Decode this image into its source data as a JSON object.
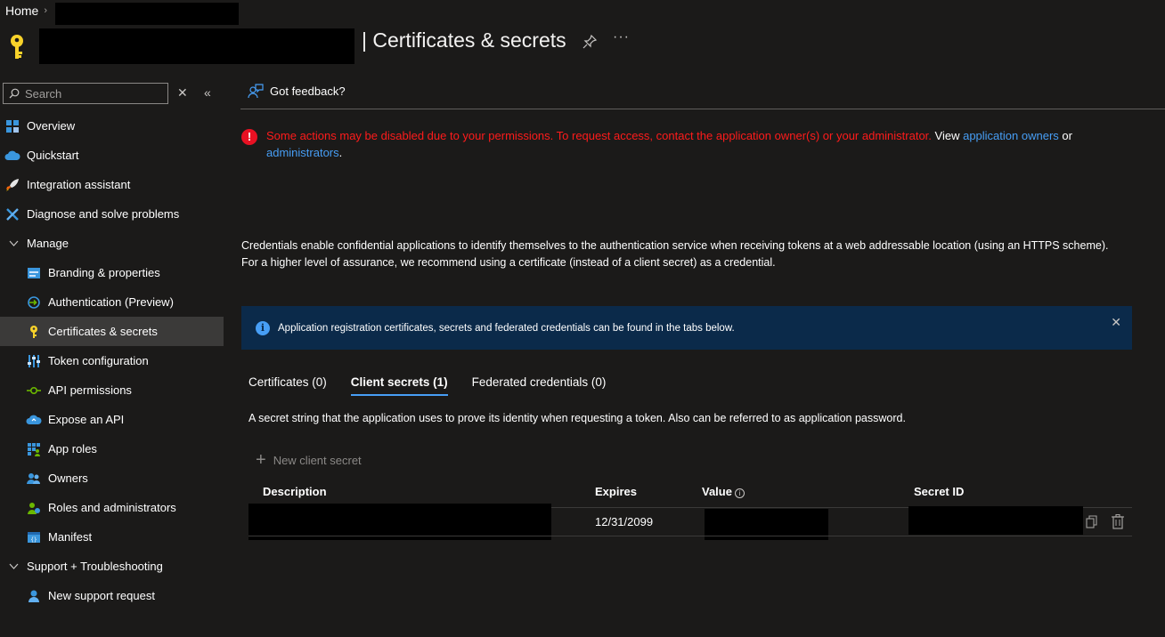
{
  "breadcrumb": {
    "home": "Home",
    "separator": "›"
  },
  "header": {
    "title": "| Certificates & secrets",
    "more": "···"
  },
  "sidebar": {
    "search_placeholder": "Search",
    "close_symbol": "✕",
    "collapse_symbol": "«",
    "items": [
      {
        "label": "Overview"
      },
      {
        "label": "Quickstart"
      },
      {
        "label": "Integration assistant"
      },
      {
        "label": "Diagnose and solve problems"
      },
      {
        "label": "Manage"
      },
      {
        "label": "Branding & properties"
      },
      {
        "label": "Authentication (Preview)"
      },
      {
        "label": "Certificates & secrets"
      },
      {
        "label": "Token configuration"
      },
      {
        "label": "API permissions"
      },
      {
        "label": "Expose an API"
      },
      {
        "label": "App roles"
      },
      {
        "label": "Owners"
      },
      {
        "label": "Roles and administrators"
      },
      {
        "label": "Manifest"
      },
      {
        "label": "Support + Troubleshooting"
      },
      {
        "label": "New support request"
      }
    ]
  },
  "main": {
    "feedback_label": "Got feedback?",
    "warning": {
      "icon": "!",
      "red_text": "Some actions may be disabled due to your permissions. To request access, contact the application owner(s) or your administrator.",
      "view_text": " View ",
      "owners_link": "application owners",
      "or_text": " or",
      "admins_link": "administrators",
      "period": "."
    },
    "credentials_text": "Credentials enable confidential applications to identify themselves to the authentication service when receiving tokens at a web addressable location (using an HTTPS scheme). For a higher level of assurance, we recommend using a certificate (instead of a client secret) as a credential.",
    "info_bar": {
      "icon": "i",
      "text": "Application registration certificates, secrets and federated credentials can be found in the tabs below.",
      "close": "✕"
    },
    "tabs": [
      {
        "label": "Certificates (0)"
      },
      {
        "label": "Client secrets (1)"
      },
      {
        "label": "Federated credentials (0)"
      }
    ],
    "tab_description": "A secret string that the application uses to prove its identity when requesting a token. Also can be referred to as application password.",
    "new_secret": {
      "plus": "+",
      "label": "New client secret"
    },
    "table": {
      "headers": {
        "description": "Description",
        "expires": "Expires",
        "value": "Value",
        "value_info": "i",
        "secret_id": "Secret ID"
      },
      "rows": [
        {
          "expires": "12/31/2099"
        }
      ]
    }
  },
  "colors": {
    "accent": "#479ef5",
    "error": "#ff1b1b",
    "info_bg": "#0b2a4a",
    "active_nav": "#3b3a39"
  }
}
